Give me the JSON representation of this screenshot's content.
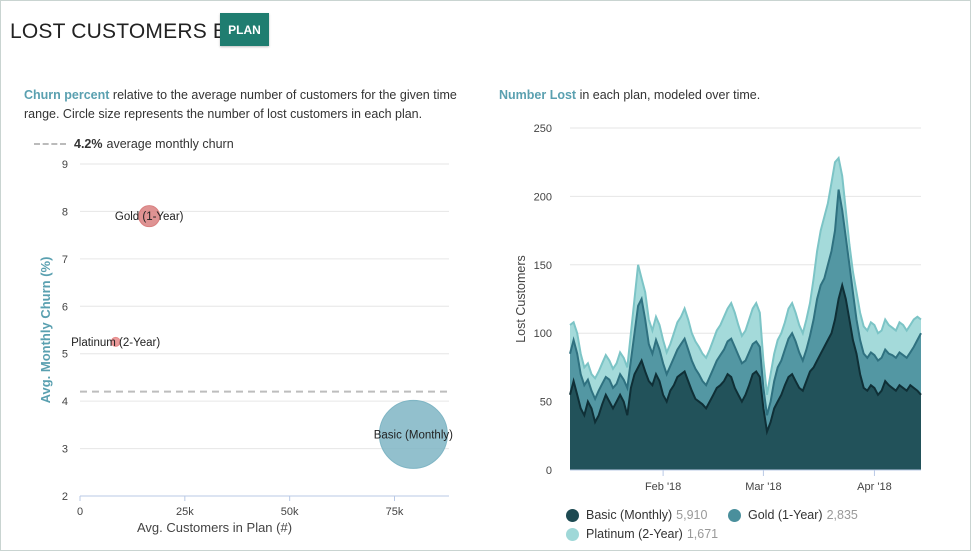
{
  "header": {
    "title": "LOST CUSTOMERS BY",
    "plan_button": "PLAN"
  },
  "colors": {
    "accent": "#1f7d70",
    "highlight": "#5aa0b0",
    "basic": "#1d4a52",
    "gold": "#4a8f9c",
    "platinum": "#9fd8d8",
    "gold_bubble": "#d98080",
    "basic_bubble": "#7fb5c4"
  },
  "left_panel": {
    "desc_highlight": "Churn percent",
    "desc_rest": " relative to the average number of customers for the given time range. Circle size represents the number of lost customers in each plan.",
    "avg_value": "4.2%",
    "avg_label": "average monthly churn"
  },
  "right_panel": {
    "desc_highlight": "Number Lost",
    "desc_rest": " in each plan, modeled over time."
  },
  "chart_data": [
    {
      "type": "scatter",
      "xlabel": "Avg. Customers in Plan (#)",
      "ylabel": "Avg. Monthly Churn (%)",
      "xlim": [
        0,
        88000
      ],
      "ylim": [
        2,
        9
      ],
      "x_ticks": [
        0,
        25000,
        50000,
        75000
      ],
      "x_tick_labels": [
        "0",
        "25k",
        "50k",
        "75k"
      ],
      "y_ticks": [
        2,
        3,
        4,
        5,
        6,
        7,
        8,
        9
      ],
      "reference_line": {
        "y": 4.2
      },
      "points": [
        {
          "label": "Gold (1-Year)",
          "x": 16500,
          "y": 7.9,
          "lost": 2835,
          "color": "#d98080"
        },
        {
          "label": "Platinum (2-Year)",
          "x": 8500,
          "y": 5.25,
          "lost": 1671,
          "color": "#e88a8a"
        },
        {
          "label": "Basic (Monthly)",
          "x": 79500,
          "y": 3.3,
          "lost": 5910,
          "color": "#7fb5c4"
        }
      ]
    },
    {
      "type": "area",
      "ylabel": "Lost Customers",
      "xlabel": "",
      "x": [
        "2018-01-06",
        "2018-01-07",
        "2018-01-08",
        "2018-01-09",
        "2018-01-10",
        "2018-01-11",
        "2018-01-12",
        "2018-01-13",
        "2018-01-14",
        "2018-01-15",
        "2018-01-16",
        "2018-01-17",
        "2018-01-18",
        "2018-01-19",
        "2018-01-20",
        "2018-01-21",
        "2018-01-22",
        "2018-01-23",
        "2018-01-24",
        "2018-01-25",
        "2018-01-26",
        "2018-01-27",
        "2018-01-28",
        "2018-01-29",
        "2018-01-30",
        "2018-01-31",
        "2018-02-01",
        "2018-02-02",
        "2018-02-03",
        "2018-02-04",
        "2018-02-05",
        "2018-02-06",
        "2018-02-07",
        "2018-02-08",
        "2018-02-09",
        "2018-02-10",
        "2018-02-11",
        "2018-02-12",
        "2018-02-13",
        "2018-02-14",
        "2018-02-15",
        "2018-02-16",
        "2018-02-17",
        "2018-02-18",
        "2018-02-19",
        "2018-02-20",
        "2018-02-21",
        "2018-02-22",
        "2018-02-23",
        "2018-02-24",
        "2018-02-25",
        "2018-02-26",
        "2018-02-27",
        "2018-02-28",
        "2018-03-01",
        "2018-03-02",
        "2018-03-03",
        "2018-03-04",
        "2018-03-05",
        "2018-03-06",
        "2018-03-07",
        "2018-03-08",
        "2018-03-09",
        "2018-03-10",
        "2018-03-11",
        "2018-03-12",
        "2018-03-13",
        "2018-03-14",
        "2018-03-15",
        "2018-03-16",
        "2018-03-17",
        "2018-03-18",
        "2018-03-19",
        "2018-03-20",
        "2018-03-21",
        "2018-03-22",
        "2018-03-23",
        "2018-03-24",
        "2018-03-25",
        "2018-03-26",
        "2018-03-27",
        "2018-03-28",
        "2018-03-29",
        "2018-03-30",
        "2018-03-31",
        "2018-04-01",
        "2018-04-02",
        "2018-04-03",
        "2018-04-04",
        "2018-04-05",
        "2018-04-06",
        "2018-04-07",
        "2018-04-08",
        "2018-04-09",
        "2018-04-10",
        "2018-04-11",
        "2018-04-12",
        "2018-04-13",
        "2018-04-14"
      ],
      "x_tick_labels": [
        "Feb '18",
        "Mar '18",
        "Apr '18"
      ],
      "x_tick_dates": [
        "2018-02-01",
        "2018-03-01",
        "2018-04-01"
      ],
      "ylim": [
        0,
        250
      ],
      "y_ticks": [
        0,
        50,
        100,
        150,
        200,
        250
      ],
      "stacking": "overlapping totals",
      "series": [
        {
          "name": "Basic (Monthly)",
          "total": "5,910",
          "color": "#1d4a52",
          "values": [
            55,
            65,
            55,
            45,
            40,
            50,
            45,
            35,
            40,
            48,
            55,
            50,
            45,
            50,
            55,
            50,
            40,
            60,
            70,
            75,
            80,
            72,
            65,
            62,
            70,
            65,
            55,
            50,
            58,
            62,
            68,
            70,
            72,
            65,
            58,
            52,
            50,
            48,
            45,
            50,
            55,
            60,
            62,
            65,
            70,
            68,
            60,
            55,
            50,
            55,
            62,
            70,
            72,
            68,
            45,
            28,
            35,
            45,
            50,
            55,
            62,
            68,
            70,
            65,
            60,
            58,
            65,
            72,
            75,
            80,
            85,
            90,
            95,
            100,
            110,
            125,
            135,
            125,
            110,
            95,
            85,
            70,
            60,
            58,
            62,
            60,
            55,
            58,
            65,
            62,
            60,
            58,
            62,
            60,
            58,
            62,
            60,
            58,
            55
          ]
        },
        {
          "name": "Gold (1-Year)",
          "total": "2,835",
          "color": "#4a8f9c",
          "values": [
            85,
            95,
            85,
            70,
            62,
            66,
            58,
            52,
            58,
            63,
            68,
            66,
            60,
            63,
            70,
            66,
            60,
            80,
            100,
            120,
            125,
            110,
            92,
            85,
            95,
            88,
            78,
            70,
            76,
            82,
            88,
            92,
            96,
            88,
            80,
            74,
            70,
            65,
            62,
            68,
            74,
            80,
            84,
            88,
            94,
            96,
            90,
            84,
            78,
            80,
            86,
            92,
            94,
            90,
            60,
            40,
            50,
            65,
            75,
            80,
            88,
            96,
            100,
            94,
            86,
            80,
            88,
            98,
            110,
            125,
            135,
            140,
            150,
            160,
            175,
            205,
            190,
            170,
            150,
            130,
            110,
            95,
            85,
            82,
            86,
            84,
            80,
            82,
            88,
            85,
            84,
            82,
            86,
            84,
            82,
            86,
            90,
            95,
            100
          ]
        },
        {
          "name": "Platinum (2-Year)",
          "total": "1,671",
          "color": "#9fd8d8",
          "values": [
            106,
            108,
            100,
            85,
            75,
            78,
            70,
            67,
            72,
            78,
            84,
            80,
            74,
            78,
            86,
            82,
            75,
            100,
            125,
            150,
            140,
            130,
            110,
            102,
            112,
            106,
            95,
            86,
            92,
            100,
            108,
            112,
            118,
            110,
            100,
            94,
            90,
            85,
            82,
            88,
            95,
            102,
            106,
            112,
            118,
            122,
            115,
            106,
            98,
            102,
            110,
            118,
            122,
            115,
            80,
            55,
            70,
            85,
            95,
            100,
            108,
            118,
            122,
            115,
            106,
            100,
            110,
            122,
            140,
            160,
            175,
            185,
            195,
            210,
            225,
            228,
            215,
            190,
            165,
            145,
            130,
            115,
            105,
            102,
            108,
            106,
            100,
            102,
            110,
            106,
            104,
            102,
            108,
            106,
            102,
            106,
            110,
            112,
            110
          ]
        }
      ]
    }
  ]
}
